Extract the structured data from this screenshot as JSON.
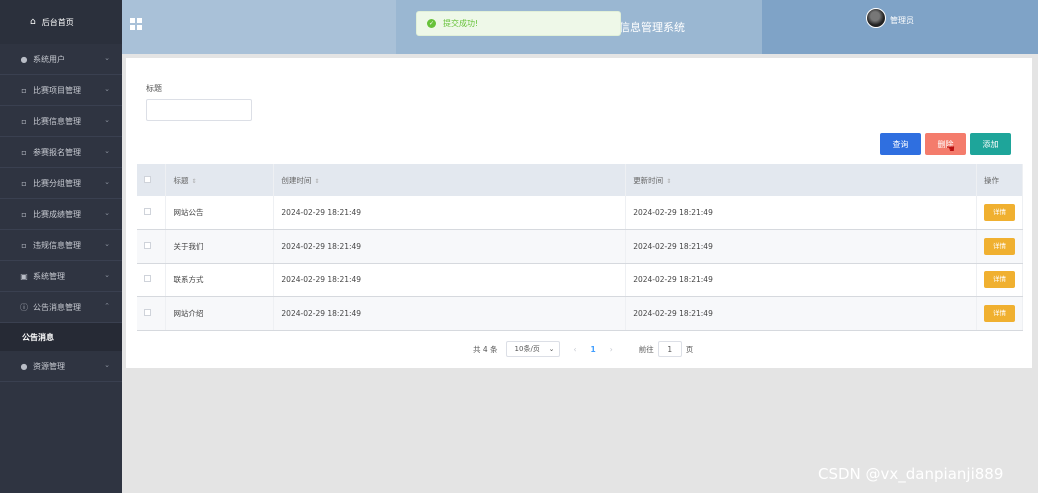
{
  "sidebar": {
    "home": "后台首页",
    "items": [
      {
        "label": "系统用户"
      },
      {
        "label": "比赛项目管理"
      },
      {
        "label": "比赛信息管理"
      },
      {
        "label": "参赛报名管理"
      },
      {
        "label": "比赛分组管理"
      },
      {
        "label": "比赛成绩管理"
      },
      {
        "label": "违规信息管理"
      },
      {
        "label": "系统管理"
      },
      {
        "label": "公告消息管理"
      }
    ],
    "subitem": "公告消息",
    "last_item": "资源管理"
  },
  "header": {
    "title_fragment": "信息管理系统",
    "admin": "管理员"
  },
  "toast": {
    "message": "提交成功!"
  },
  "filter": {
    "label": "标题",
    "value": ""
  },
  "buttons": {
    "query": "查询",
    "delete": "删除",
    "add": "添加"
  },
  "table": {
    "columns": [
      "标题",
      "创建时间",
      "更新时间",
      "操作"
    ],
    "rows": [
      {
        "title": "网站公告",
        "created": "2024-02-29 18:21:49",
        "updated": "2024-02-29 18:21:49",
        "action": "详情"
      },
      {
        "title": "关于我们",
        "created": "2024-02-29 18:21:49",
        "updated": "2024-02-29 18:21:49",
        "action": "详情"
      },
      {
        "title": "联系方式",
        "created": "2024-02-29 18:21:49",
        "updated": "2024-02-29 18:21:49",
        "action": "详情"
      },
      {
        "title": "网站介绍",
        "created": "2024-02-29 18:21:49",
        "updated": "2024-02-29 18:21:49",
        "action": "详情"
      }
    ]
  },
  "pagination": {
    "total": "共 4 条",
    "page_size": "10条/页",
    "current_page": "1",
    "goto_label": "前往",
    "goto_value": "1",
    "goto_unit": "页"
  },
  "watermark": "CSDN @vx_danpianji889",
  "colors": {
    "sidebar": "#2f3441",
    "query": "#2f6fe0",
    "delete": "#f47c6c",
    "add": "#1ea59a",
    "detail": "#f0b030",
    "success": "#67c23a"
  }
}
